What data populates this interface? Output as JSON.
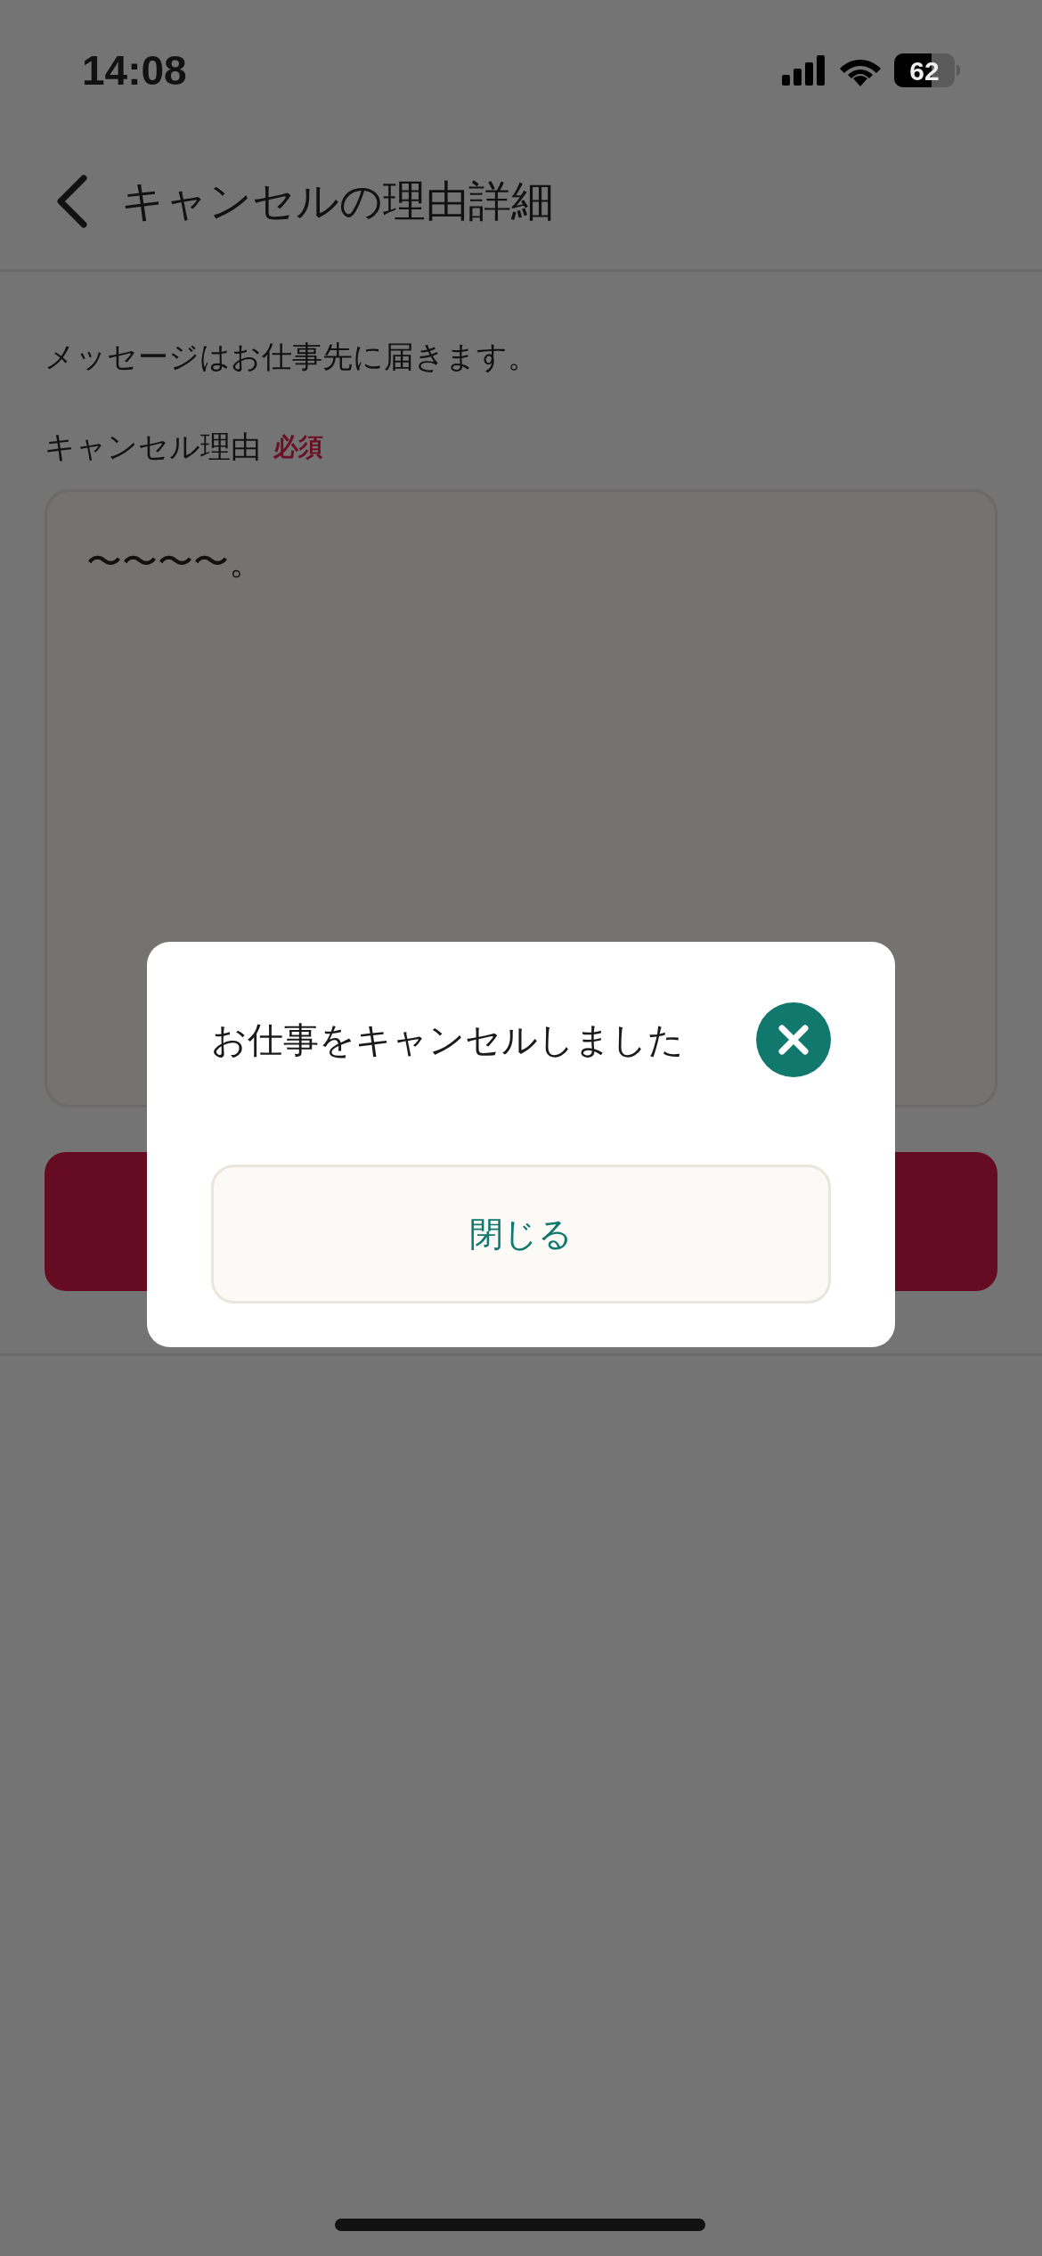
{
  "status_bar": {
    "time": "14:08",
    "battery": "62"
  },
  "header": {
    "title": "キャンセルの理由詳細"
  },
  "notice": "メッセージはお仕事先に届きます。",
  "reason_field": {
    "label": "キャンセル理由",
    "required_badge": "必須",
    "value": "〜〜〜〜。"
  },
  "dialog": {
    "message": "お仕事をキャンセルしました",
    "close_button": "閉じる"
  }
}
